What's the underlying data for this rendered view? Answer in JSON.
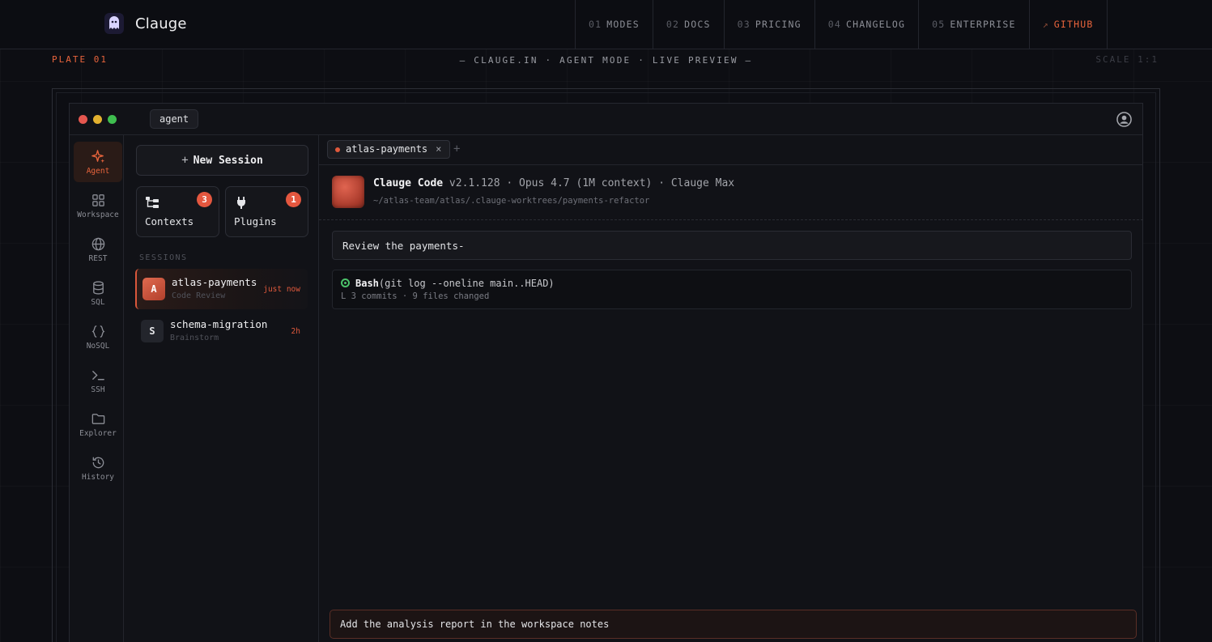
{
  "brand": {
    "name": "Clauge"
  },
  "nav": [
    {
      "num": "01",
      "label": "MODES"
    },
    {
      "num": "02",
      "label": "DOCS"
    },
    {
      "num": "03",
      "label": "PRICING"
    },
    {
      "num": "04",
      "label": "CHANGELOG"
    },
    {
      "num": "05",
      "label": "ENTERPRISE"
    },
    {
      "num": "↗",
      "label": "GITHUB"
    }
  ],
  "plate": {
    "left": "PLATE 01",
    "center": "— CLAUGE.IN · AGENT MODE · LIVE PREVIEW —",
    "right": "SCALE 1:1"
  },
  "window": {
    "mode": "agent"
  },
  "rail": [
    {
      "label": "Agent",
      "icon": "sparkle-icon"
    },
    {
      "label": "Workspace",
      "icon": "grid-icon"
    },
    {
      "label": "REST",
      "icon": "globe-icon"
    },
    {
      "label": "SQL",
      "icon": "database-icon"
    },
    {
      "label": "NoSQL",
      "icon": "braces-icon"
    },
    {
      "label": "SSH",
      "icon": "terminal-icon"
    },
    {
      "label": "Explorer",
      "icon": "folder-icon"
    },
    {
      "label": "History",
      "icon": "history-icon"
    }
  ],
  "panel": {
    "new_session": "New Session",
    "cards": [
      {
        "label": "Contexts",
        "badge": "3",
        "icon": "folder-tree-icon"
      },
      {
        "label": "Plugins",
        "badge": "1",
        "icon": "plug-icon"
      }
    ],
    "sessions_title": "SESSIONS",
    "sessions": [
      {
        "initial": "A",
        "name": "atlas-payments",
        "sub": "Code Review",
        "time": "just now"
      },
      {
        "initial": "S",
        "name": "schema-migration",
        "sub": "Brainstorm",
        "time": "2h"
      }
    ]
  },
  "main": {
    "tab": {
      "label": "atlas-payments",
      "close": "×",
      "add": "+"
    },
    "header": {
      "product": "Clauge Code",
      "details": " v2.1.128 · Opus 4.7 (1M context) · Clauge Max",
      "path": "~/atlas-team/atlas/.clauge-worktrees/payments-refactor"
    },
    "prompt": "Review the payments-",
    "tool": {
      "name": "Bash",
      "args": "(git log --oneline main..HEAD)",
      "result": "L 3 commits · 9 files changed"
    },
    "composer": "Add the analysis report in the workspace notes"
  },
  "colors": {
    "accent": "#e8643c",
    "success": "#4cc36a",
    "background": "#0d0e13"
  }
}
